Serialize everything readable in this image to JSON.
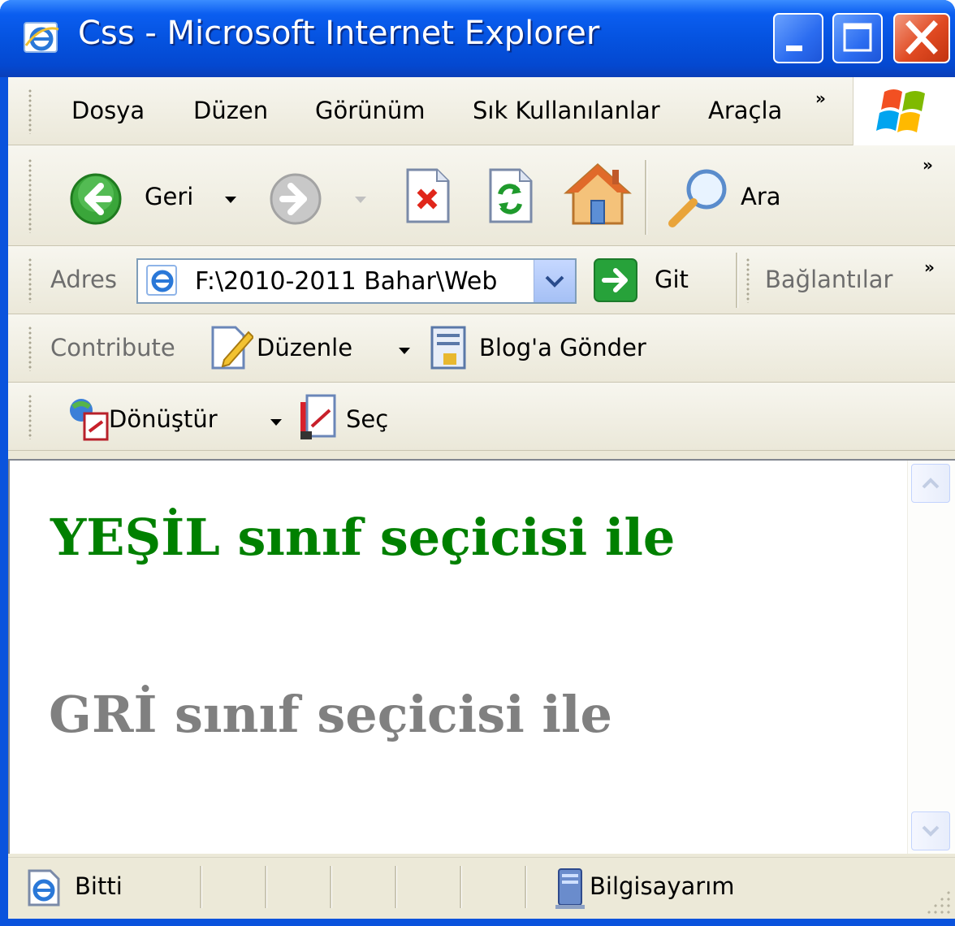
{
  "window": {
    "title": "Css - Microsoft Internet Explorer",
    "icon": "ie-icon",
    "controls": [
      "minimize-icon",
      "maximize-icon",
      "close-icon"
    ],
    "title_color": "#0a53dd"
  },
  "menubar": {
    "items": [
      {
        "label": "Dosya"
      },
      {
        "label": "Düzen"
      },
      {
        "label": "Görünüm"
      },
      {
        "label": "Sık Kullanılanlar"
      },
      {
        "label": "Araçla"
      }
    ],
    "overflow": "»"
  },
  "toolbar": {
    "back_label": "Geri",
    "search_label": "Ara",
    "overflow": "»",
    "icons": [
      "back-icon",
      "forward-icon",
      "stop-icon",
      "refresh-icon",
      "home-icon",
      "search-icon"
    ]
  },
  "addressbar": {
    "label": "Adres",
    "value": "F:\\2010-2011 Bahar\\Web",
    "go_label": "Git",
    "links_label": "Bağlantılar",
    "overflow": "»"
  },
  "contribute": {
    "label": "Contribute",
    "edit_label": "Düzenle",
    "blog_label": "Blog'a Gönder"
  },
  "pdfbar": {
    "convert_label": "Dönüştür",
    "select_label": "Seç"
  },
  "content": {
    "green_heading": "YEŞİL sınıf seçicisi ile",
    "gray_heading": "GRİ sınıf seçicisi ile",
    "green_color": "#008000",
    "gray_color": "#808080"
  },
  "statusbar": {
    "status": "Bitti",
    "zone": "Bilgisayarım"
  }
}
